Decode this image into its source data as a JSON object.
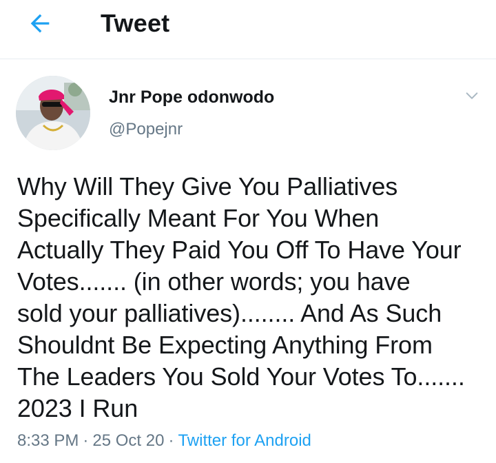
{
  "header": {
    "title": "Tweet",
    "back_icon": "arrow-left-icon",
    "accent_color": "#1da1f2"
  },
  "author": {
    "display_name": "Jnr Pope odonwodo",
    "handle": "@Popejnr",
    "avatar_icon": "profile-photo",
    "menu_icon": "chevron-down-icon"
  },
  "tweet": {
    "lines": [
      "Why Will They Give You Palliatives",
      "Specifically Meant For You When",
      "Actually They Paid You Off To Have Your",
      "Votes....... (in other words; you have",
      "sold your palliatives)........ And As Such",
      "Shouldnt Be Expecting Anything From",
      "The Leaders You Sold Your Votes To.......",
      "2023 I Run"
    ]
  },
  "meta": {
    "time": "8:33 PM",
    "separator": "·",
    "date": "25 Oct 20",
    "source": "Twitter for Android",
    "source_color": "#1da1f2"
  }
}
